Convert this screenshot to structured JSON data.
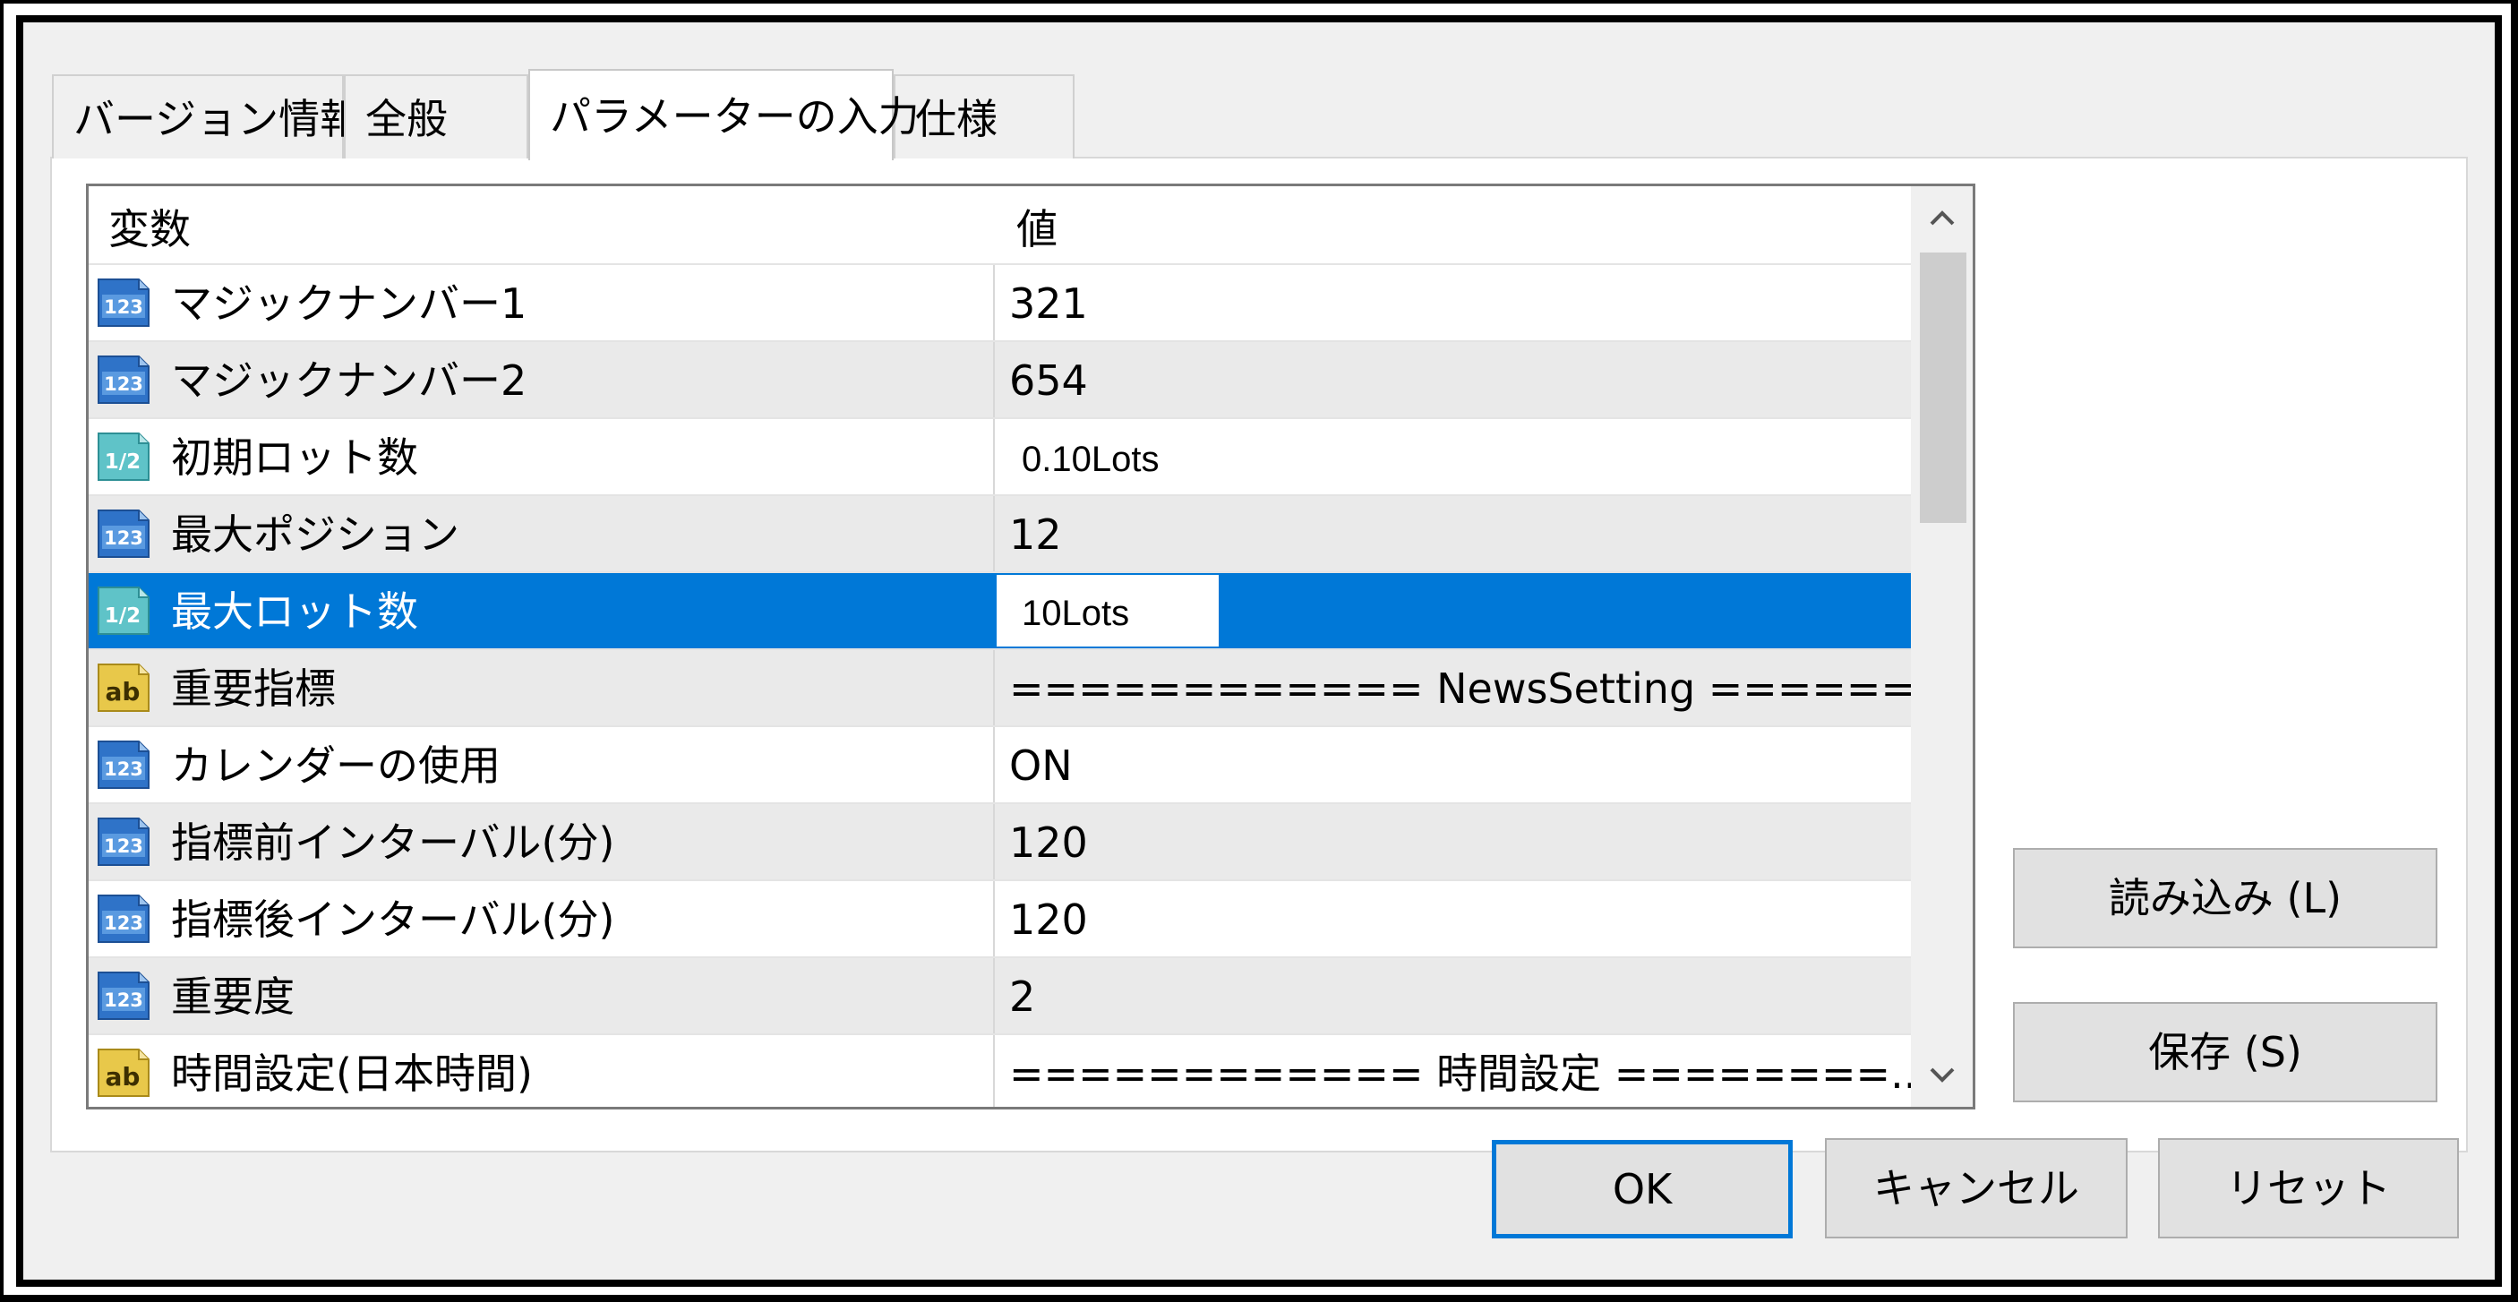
{
  "tabs": [
    {
      "label": "バージョン情報"
    },
    {
      "label": "全般"
    },
    {
      "label": "パラメーターの入力",
      "active": true
    },
    {
      "label": "仕様"
    }
  ],
  "table": {
    "headers": {
      "name": "変数",
      "value": "値"
    },
    "rows": [
      {
        "type_icon": "int-123-icon",
        "name": "マジックナンバー1",
        "value": "321"
      },
      {
        "type_icon": "int-123-icon",
        "name": "マジックナンバー2",
        "value": "654"
      },
      {
        "type_icon": "double-half-icon",
        "name": "初期ロット数",
        "value": "0.10Lots"
      },
      {
        "type_icon": "int-123-icon",
        "name": "最大ポジション",
        "value": "12"
      },
      {
        "type_icon": "double-half-icon",
        "name": "最大ロット数",
        "value": "10Lots",
        "selected": true
      },
      {
        "type_icon": "string-ab-icon",
        "name": "重要指標",
        "value": "============ NewsSetting ======..."
      },
      {
        "type_icon": "int-123-icon",
        "name": "カレンダーの使用",
        "value": "ON"
      },
      {
        "type_icon": "int-123-icon",
        "name": "指標前インターバル(分)",
        "value": "120"
      },
      {
        "type_icon": "int-123-icon",
        "name": "指標後インターバル(分)",
        "value": "120"
      },
      {
        "type_icon": "int-123-icon",
        "name": "重要度",
        "value": "2"
      },
      {
        "type_icon": "string-ab-icon",
        "name": "時間設定(日本時間)",
        "value": "============ 時間設定 ========..."
      }
    ]
  },
  "buttons": {
    "load": "読み込み (L)",
    "save": "保存 (S)",
    "ok": "OK",
    "cancel": "キャンセル",
    "reset": "リセット"
  },
  "colors": {
    "selection": "#0078d7",
    "alt_row": "#eaeaea"
  }
}
